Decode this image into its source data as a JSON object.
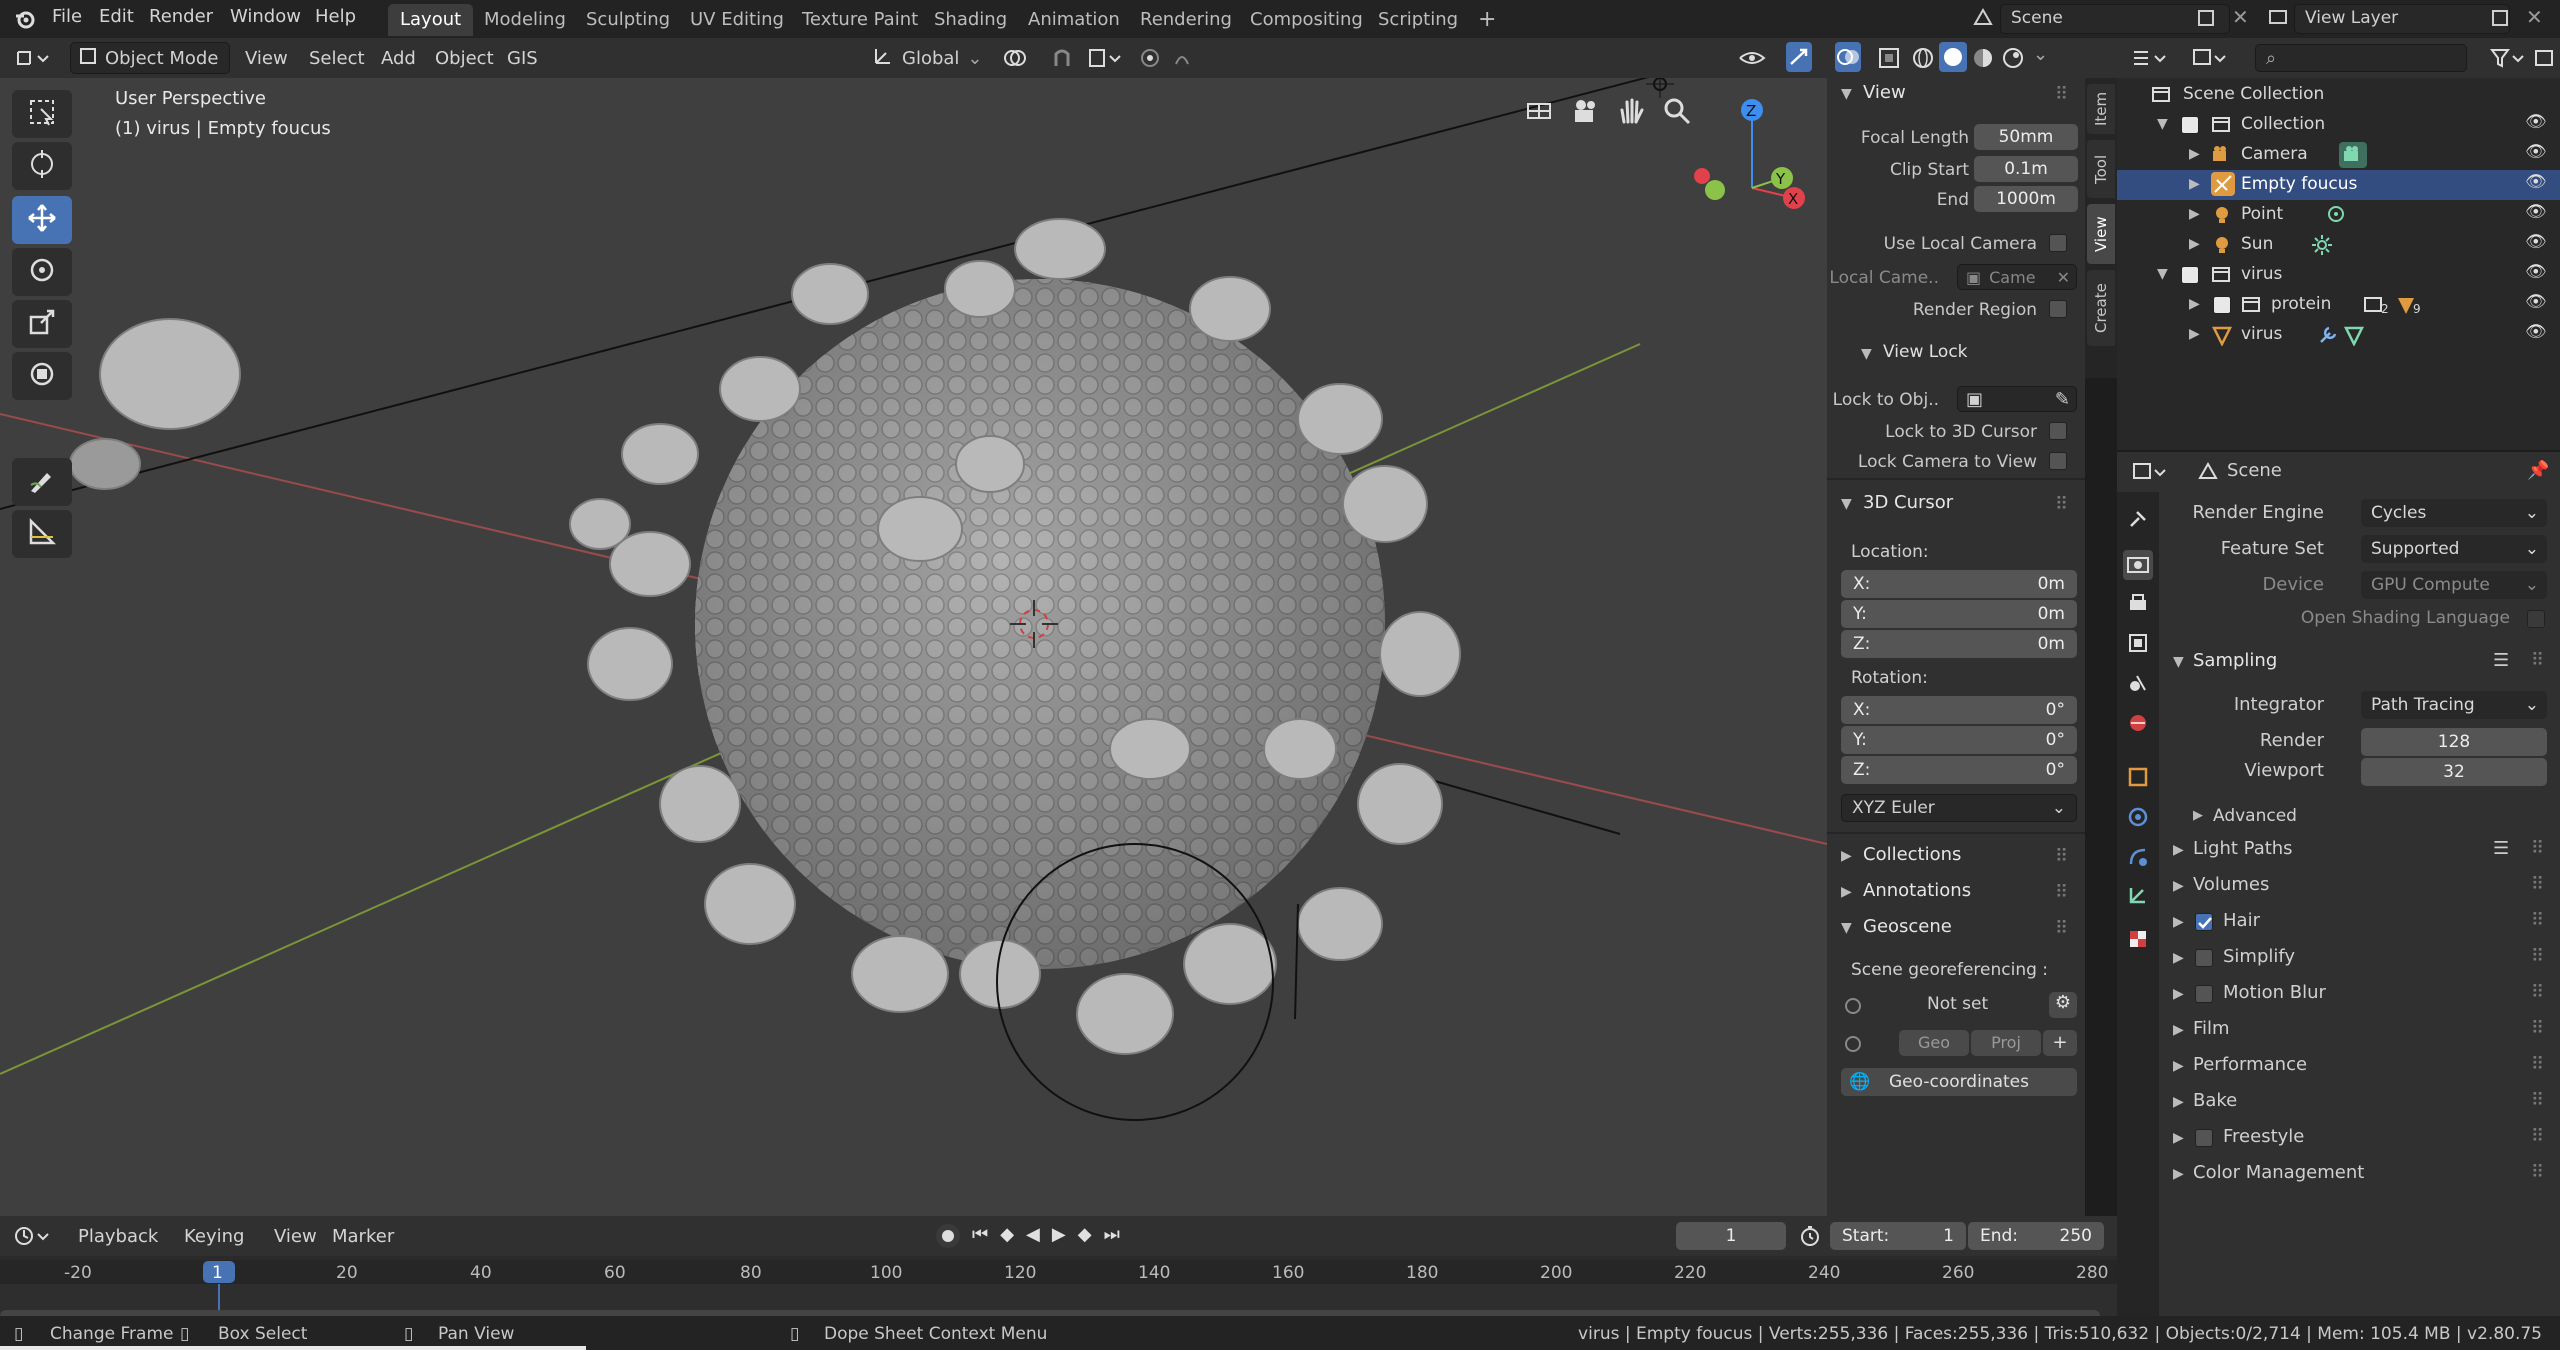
{
  "topbar": {
    "menus": [
      "File",
      "Edit",
      "Render",
      "Window",
      "Help"
    ],
    "workspaces": [
      "Layout",
      "Modeling",
      "Sculpting",
      "UV Editing",
      "Texture Paint",
      "Shading",
      "Animation",
      "Rendering",
      "Compositing",
      "Scripting"
    ],
    "active_workspace": "Layout",
    "scene": "Scene",
    "view_layer": "View Layer",
    "add_tab": "+"
  },
  "viewport_header": {
    "mode": "Object Mode",
    "menus": [
      "View",
      "Select",
      "Add",
      "Object",
      "GIS"
    ],
    "orientation": "Global"
  },
  "viewport": {
    "perspective": "User Perspective",
    "context": "(1) virus | Empty foucus",
    "gizmo": {
      "x": "X",
      "y": "Y",
      "z": "Z"
    }
  },
  "npanel": {
    "view_title": "View",
    "focal_length_label": "Focal Length",
    "focal_length": "50mm",
    "clip_start_label": "Clip Start",
    "clip_start": "0.1m",
    "end_label": "End",
    "end": "1000m",
    "use_local_camera": "Use Local Camera",
    "local_camera_label": "Local Came..",
    "local_camera_value": "Came",
    "render_region": "Render Region",
    "view_lock_title": "View Lock",
    "lock_to_obj": "Lock to Obj..",
    "lock_to_cursor": "Lock to 3D Cursor",
    "lock_camera": "Lock Camera to View",
    "cursor_title": "3D Cursor",
    "location_label": "Location:",
    "loc_x": "X:",
    "loc_x_val": "0m",
    "loc_y": "Y:",
    "loc_y_val": "0m",
    "loc_z": "Z:",
    "loc_z_val": "0m",
    "rotation_label": "Rotation:",
    "rot_x": "X:",
    "rot_x_val": "0°",
    "rot_y": "Y:",
    "rot_y_val": "0°",
    "rot_z": "Z:",
    "rot_z_val": "0°",
    "rotation_mode": "XYZ Euler",
    "collections": "Collections",
    "annotations": "Annotations",
    "geoscene": "Geoscene",
    "georef_label": "Scene georeferencing :",
    "not_set": "Not set",
    "geo": "Geo",
    "proj": "Proj",
    "geo_plus": "+",
    "geo_coords": "Geo-coordinates"
  },
  "sidetabs": [
    "Item",
    "Tool",
    "View",
    "Create"
  ],
  "outliner": {
    "root": "Scene Collection",
    "items": [
      {
        "label": "Collection",
        "depth": 1
      },
      {
        "label": "Camera",
        "depth": 2
      },
      {
        "label": "Empty foucus",
        "depth": 2
      },
      {
        "label": "Point",
        "depth": 2
      },
      {
        "label": "Sun",
        "depth": 2
      },
      {
        "label": "virus",
        "depth": 1
      },
      {
        "label": "protein",
        "depth": 2
      },
      {
        "label": "virus",
        "depth": 2
      }
    ],
    "protein_count": "2",
    "protein_mesh_count": "9"
  },
  "properties": {
    "header": "Scene",
    "render_engine_label": "Render Engine",
    "render_engine": "Cycles",
    "feature_set_label": "Feature Set",
    "feature_set": "Supported",
    "device_label": "Device",
    "device": "GPU Compute",
    "osl": "Open Shading Language",
    "sampling": "Sampling",
    "integrator_label": "Integrator",
    "integrator": "Path Tracing",
    "render_label": "Render",
    "render_samples": "128",
    "viewport_label": "Viewport",
    "viewport_samples": "32",
    "advanced": "Advanced",
    "light_paths": "Light Paths",
    "volumes": "Volumes",
    "hair": "Hair",
    "simplify": "Simplify",
    "motion_blur": "Motion Blur",
    "film": "Film",
    "performance": "Performance",
    "bake": "Bake",
    "freestyle": "Freestyle",
    "color_management": "Color Management"
  },
  "timeline": {
    "menus": [
      "Playback",
      "Keying",
      "View",
      "Marker"
    ],
    "current_frame": "1",
    "start_label": "Start:",
    "start": "1",
    "end_label": "End:",
    "end": "250",
    "ticks": [
      "-20",
      "20",
      "40",
      "60",
      "80",
      "100",
      "120",
      "140",
      "160",
      "180",
      "200",
      "220",
      "240",
      "260",
      "280"
    ],
    "cursor_frame": "1"
  },
  "status": {
    "change_frame": "Change Frame",
    "box_select": "Box Select",
    "pan_view": "Pan View",
    "context_menu": "Dope Sheet Context Menu",
    "stats": "virus | Empty foucus | Verts:255,336 | Faces:255,336 | Tris:510,632 | Objects:0/2,714 | Mem: 105.4 MB | v2.80.75"
  },
  "colors": {
    "accent": "#4772b3",
    "x_axis": "#e0414a",
    "y_axis": "#8bc34a",
    "z_axis": "#3d8ef0"
  }
}
